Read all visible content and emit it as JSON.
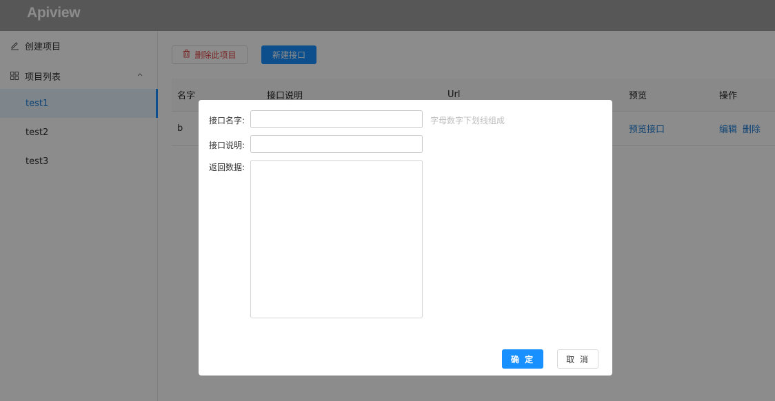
{
  "app": {
    "title": "Apiview"
  },
  "colors": {
    "primary": "#1890ff",
    "danger": "#e04646",
    "link": "#1f7cd4"
  },
  "sidebar": {
    "create_project": {
      "label": "创建项目",
      "icon": "edit-icon"
    },
    "project_list": {
      "label": "项目列表",
      "icon": "grid-icon",
      "expanded": true
    },
    "projects": [
      {
        "label": "test1",
        "active": true
      },
      {
        "label": "test2",
        "active": false
      },
      {
        "label": "test3",
        "active": false
      }
    ]
  },
  "toolbar": {
    "delete_project": {
      "label": "删除此项目",
      "icon": "trash-icon"
    },
    "new_api": {
      "label": "新建接口"
    }
  },
  "table": {
    "columns": [
      "名字",
      "接口说明",
      "Url",
      "预览",
      "操作"
    ],
    "rows": [
      {
        "name": "b",
        "desc": "",
        "url": "",
        "preview": "预览接口",
        "actions": [
          "编辑",
          "删除"
        ]
      }
    ]
  },
  "modal": {
    "name_label": "接口名字:",
    "name_value": "",
    "name_hint": "字母数字下划线组成",
    "desc_label": "接口说明:",
    "desc_value": "",
    "data_label": "返回数据:",
    "data_value": "",
    "ok_label": "确 定",
    "cancel_label": "取 消"
  }
}
